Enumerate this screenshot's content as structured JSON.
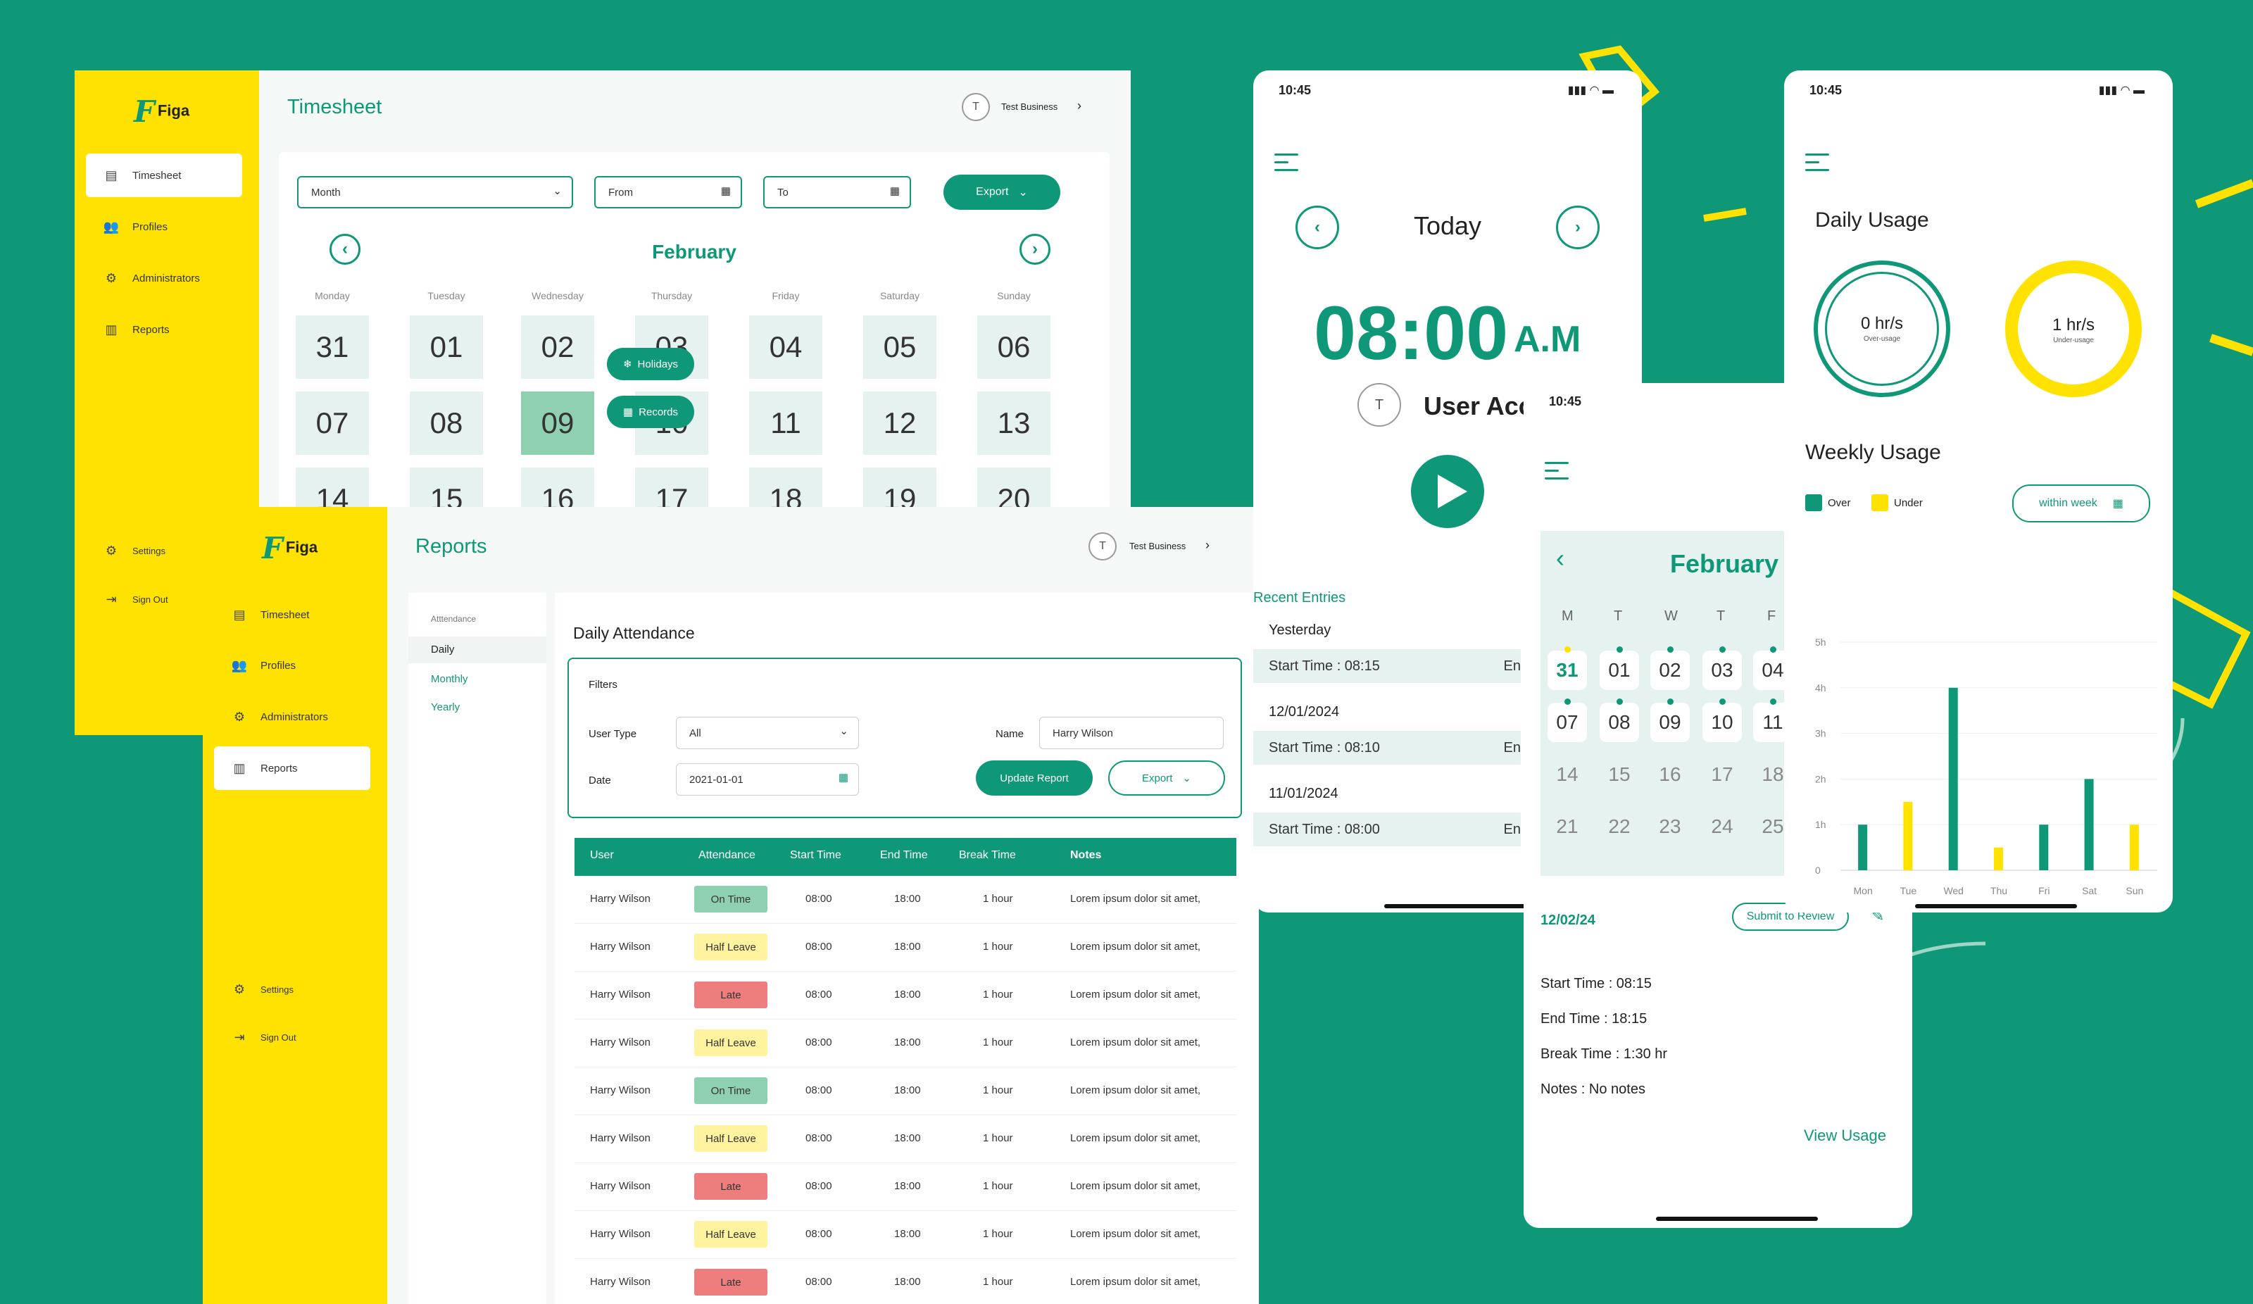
{
  "timesheet": {
    "logo": "Figa",
    "nav": [
      "Timesheet",
      "Profiles",
      "Administrators",
      "Reports"
    ],
    "nav_bottom": [
      "Settings",
      "Sign Out"
    ],
    "title": "Timesheet",
    "avatar": "T",
    "business": "Test Business",
    "month_select": "Month",
    "from": "From",
    "to": "To",
    "export": "Export",
    "month": "February",
    "weekdays": [
      "Monday",
      "Tuesday",
      "Wednesday",
      "Thursday",
      "Friday",
      "Saturday",
      "Sunday"
    ],
    "row1": [
      "31",
      "01",
      "02",
      "03",
      "04",
      "05",
      "06"
    ],
    "row2": [
      "07",
      "08",
      "09",
      "10",
      "11",
      "12",
      "13"
    ],
    "row3": [
      "14",
      "15",
      "16",
      "17",
      "18",
      "19",
      "20"
    ],
    "fab_holidays": "Holidays",
    "fab_records": "Records"
  },
  "reports": {
    "logo": "Figa",
    "nav": [
      "Timesheet",
      "Profiles",
      "Administrators",
      "Reports"
    ],
    "nav_bottom": [
      "Settings",
      "Sign Out"
    ],
    "title": "Reports",
    "avatar": "T",
    "business": "Test Business",
    "subnav_header": "Atttendance",
    "subnav": [
      "Daily",
      "Monthly",
      "Yearly"
    ],
    "section_title": "Daily Attendance",
    "filters_title": "Filters",
    "user_type_label": "User Type",
    "user_type_value": "All",
    "name_label": "Name",
    "name_value": "Harry Wilson",
    "date_label": "Date",
    "date_value": "2021-01-01",
    "update_btn": "Update Report",
    "export_btn": "Export",
    "columns": [
      "User",
      "Attendance",
      "Start Time",
      "End Time",
      "Break Time",
      "Notes"
    ],
    "rows": [
      {
        "user": "Harry Wilson",
        "status": "On Time",
        "start": "08:00",
        "end": "18:00",
        "brk": "1 hour",
        "notes": "Lorem ipsum dolor sit amet,"
      },
      {
        "user": "Harry Wilson",
        "status": "Half Leave",
        "start": "08:00",
        "end": "18:00",
        "brk": "1 hour",
        "notes": "Lorem ipsum dolor sit amet,"
      },
      {
        "user": "Harry Wilson",
        "status": "Late",
        "start": "08:00",
        "end": "18:00",
        "brk": "1 hour",
        "notes": "Lorem ipsum dolor sit amet,"
      },
      {
        "user": "Harry Wilson",
        "status": "Half Leave",
        "start": "08:00",
        "end": "18:00",
        "brk": "1 hour",
        "notes": "Lorem ipsum dolor sit amet,"
      },
      {
        "user": "Harry Wilson",
        "status": "On Time",
        "start": "08:00",
        "end": "18:00",
        "brk": "1 hour",
        "notes": "Lorem ipsum dolor sit amet,"
      },
      {
        "user": "Harry Wilson",
        "status": "Half Leave",
        "start": "08:00",
        "end": "18:00",
        "brk": "1 hour",
        "notes": "Lorem ipsum dolor sit amet,"
      },
      {
        "user": "Harry Wilson",
        "status": "Late",
        "start": "08:00",
        "end": "18:00",
        "brk": "1 hour",
        "notes": "Lorem ipsum dolor sit amet,"
      },
      {
        "user": "Harry Wilson",
        "status": "Half Leave",
        "start": "08:00",
        "end": "18:00",
        "brk": "1 hour",
        "notes": "Lorem ipsum dolor sit amet,"
      },
      {
        "user": "Harry Wilson",
        "status": "Late",
        "start": "08:00",
        "end": "18:00",
        "brk": "1 hour",
        "notes": "Lorem ipsum dolor sit amet,"
      }
    ],
    "status_colors": {
      "On Time": "#8fd0b0",
      "Half Leave": "#fff3a0",
      "Late": "#ee7d7d"
    }
  },
  "phone_today": {
    "time": "10:45",
    "title": "Today",
    "clock": "08:00",
    "ampm": "A.M",
    "avatar": "T",
    "user": "User Acc",
    "recent": "Recent Entries",
    "groups": [
      {
        "date": "Yesterday",
        "entry": "Start Time : 08:15",
        "tail": "En"
      },
      {
        "date": "12/01/2024",
        "entry": "Start Time : 08:10",
        "tail": "En"
      },
      {
        "date": "11/01/2024",
        "entry": "Start Time : 08:00",
        "tail": "En"
      }
    ]
  },
  "phone_calendar": {
    "time": "10:45",
    "month": "February",
    "days": [
      "M",
      "T",
      "W",
      "T",
      "F"
    ],
    "row1": [
      "31",
      "01",
      "02",
      "03",
      "04"
    ],
    "row2": [
      "07",
      "08",
      "09",
      "10",
      "11"
    ],
    "row3": [
      "14",
      "15",
      "16",
      "17",
      "18"
    ],
    "row4": [
      "21",
      "22",
      "23",
      "24",
      "25"
    ],
    "detail_date": "12/02/24",
    "submit": "Submit to Review",
    "start": "Start Time : 08:15",
    "end": "End Time : 18:15",
    "break": "Break Time : 1:30 hr",
    "notes": "Notes : No notes",
    "view_usage": "View Usage"
  },
  "phone_usage": {
    "time": "10:45",
    "daily_title": "Daily Usage",
    "over_value": "0 hr/s",
    "over_label": "Over-usage",
    "under_value": "1 hr/s",
    "under_label": "Under-usage",
    "weekly_title": "Weekly Usage",
    "legend_over": "Over",
    "legend_under": "Under",
    "range_select": "within week",
    "colors": {
      "over": "#0e9878",
      "under": "#ffe200"
    }
  },
  "chart_data": {
    "type": "bar",
    "categories": [
      "Mon",
      "Tue",
      "Wed",
      "Thu",
      "Fri",
      "Sat",
      "Sun"
    ],
    "series": [
      {
        "name": "Over",
        "values": [
          1,
          null,
          4,
          null,
          1,
          2,
          null
        ]
      },
      {
        "name": "Under",
        "values": [
          null,
          1.5,
          null,
          0.5,
          null,
          null,
          1
        ]
      }
    ],
    "yticks": [
      "0",
      "1h",
      "2h",
      "3h",
      "4h",
      "5h"
    ],
    "ylim": [
      0,
      5
    ]
  }
}
